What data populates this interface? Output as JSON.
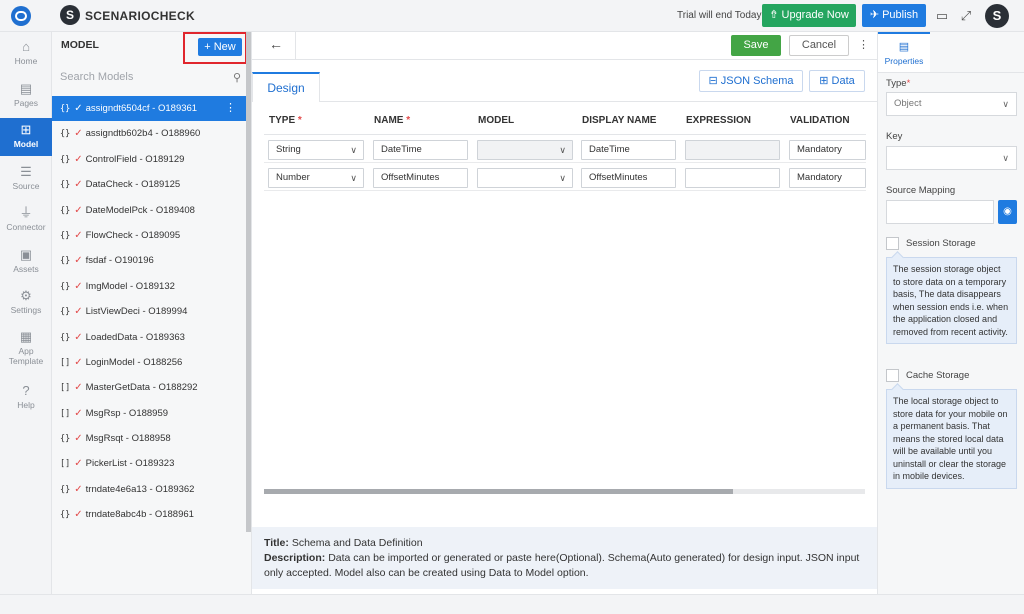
{
  "header": {
    "brand_badge": "S",
    "brand_name": "SCENARIOCHECK",
    "trial_text": "Trial will end Today",
    "upgrade_label": "⇮ Upgrade Now",
    "publish_label": "✈ Publish",
    "user_initial": "S"
  },
  "nav": {
    "items": [
      {
        "label": "Home",
        "icon": "home-icon"
      },
      {
        "label": "Pages",
        "icon": "pages-icon"
      },
      {
        "label": "Model",
        "icon": "model-grid-icon"
      },
      {
        "label": "Source",
        "icon": "database-icon"
      },
      {
        "label": "Connector",
        "icon": "plug-icon"
      },
      {
        "label": "Assets",
        "icon": "assets-icon"
      },
      {
        "label": "Settings",
        "icon": "gear-icon"
      },
      {
        "label": "App",
        "label2": "Template",
        "icon": "app-template-icon"
      },
      {
        "label": "Help",
        "icon": "help-icon"
      }
    ],
    "active": "Model"
  },
  "model_panel": {
    "title": "MODEL",
    "new_label": "+ New",
    "search_placeholder": "Search Models",
    "models": [
      {
        "brace": "{}",
        "name": "assigndt6504cf - O189361",
        "selected": true
      },
      {
        "brace": "{}",
        "name": "assigndtb602b4 - O188960"
      },
      {
        "brace": "{}",
        "name": "ControlField - O189129"
      },
      {
        "brace": "{}",
        "name": "DataCheck - O189125"
      },
      {
        "brace": "{}",
        "name": "DateModelPck - O189408"
      },
      {
        "brace": "{}",
        "name": "FlowCheck - O189095"
      },
      {
        "brace": "{}",
        "name": "fsdaf - O190196"
      },
      {
        "brace": "{}",
        "name": "ImgModel - O189132"
      },
      {
        "brace": "{}",
        "name": "ListViewDeci - O189994"
      },
      {
        "brace": "{}",
        "name": "LoadedData - O189363"
      },
      {
        "brace": "[]",
        "name": "LoginModel - O188256"
      },
      {
        "brace": "[]",
        "name": "MasterGetData - O188292"
      },
      {
        "brace": "[]",
        "name": "MsgRsp - O188959"
      },
      {
        "brace": "{}",
        "name": "MsgRsqt - O188958"
      },
      {
        "brace": "[]",
        "name": "PickerList - O189323"
      },
      {
        "brace": "{}",
        "name": "trndate4e6a13 - O189362"
      },
      {
        "brace": "{}",
        "name": "trndate8abc4b - O188961"
      }
    ]
  },
  "toolbar": {
    "save_label": "Save",
    "cancel_label": "Cancel"
  },
  "tabs": {
    "design_label": "Design",
    "json_schema_label": "JSON Schema",
    "data_label": "Data"
  },
  "grid": {
    "columns": [
      "TYPE",
      "NAME",
      "MODEL",
      "DISPLAY NAME",
      "EXPRESSION",
      "VALIDATION"
    ],
    "required_mark": "*",
    "rows": [
      {
        "type": "String",
        "name": "DateTime",
        "model": "",
        "display_name": "DateTime",
        "expression": "",
        "validation": "Mandatory"
      },
      {
        "type": "Number",
        "name": "OffsetMinutes",
        "model": "",
        "display_name": "OffsetMinutes",
        "expression": "",
        "validation": "Mandatory"
      }
    ]
  },
  "info": {
    "title_label": "Title:",
    "title_text": "Schema and Data Definition",
    "desc_label": "Description:",
    "desc_text": "Data can be imported or generated or paste here(Optional). Schema(Auto generated) for design input. JSON input only accepted. Model also can be created using Data to Model option."
  },
  "properties": {
    "tab_label": "Properties",
    "type_label": "Type",
    "type_value": "Object",
    "key_label": "Key",
    "key_value": "",
    "source_mapping_label": "Source Mapping",
    "session_storage_label": "Session Storage",
    "session_storage_tip": "The session storage object to store data on a temporary basis, The data disappears when session ends i.e. when the application closed and removed from recent activity.",
    "cache_storage_label": "Cache Storage",
    "cache_storage_tip": "The local storage object to store data for your mobile on a permanent basis. That means the stored local data will be available until you uninstall or clear the storage in mobile devices."
  },
  "colors": {
    "primary": "#1f7be0",
    "nav_active": "#1f6fd0",
    "save_green": "#43a545",
    "upgrade_green": "#24a55f",
    "required_red": "#e24a4a",
    "highlight_red": "#e0262d"
  }
}
